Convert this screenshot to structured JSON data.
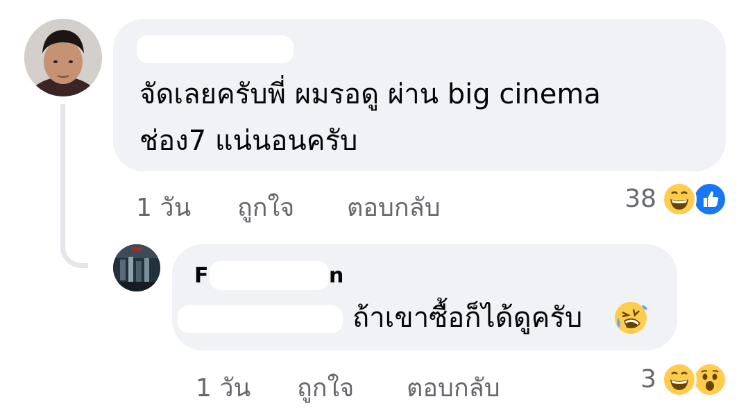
{
  "comments": [
    {
      "author": "",
      "body_lines": [
        "จัดเลยครับพี่ ผมรอดู ผ่าน big cinema",
        "ช่อง7 แน่นอนครับ"
      ],
      "time": "1 วัน",
      "like_label": "ถูกใจ",
      "reply_label": "ตอบกลับ",
      "reaction_count": "38",
      "reactions": [
        "grinning-face",
        "like-thumb"
      ]
    },
    {
      "author_visible": "F",
      "author_visible_end": "n",
      "mention": "",
      "body": "ถ้าเขาซื้อก็ได้ดูครับ",
      "time": "1 วัน",
      "like_label": "ถูกใจ",
      "reply_label": "ตอบกลับ",
      "reaction_count": "3",
      "reactions": [
        "grinning-face",
        "surprised-face"
      ]
    }
  ],
  "colors": {
    "bubble": "#f0f2f5",
    "meta_text": "#65676b",
    "mention": "#216fdb",
    "like_blue": "#1877f2",
    "emoji_yellow": "#ffcc4d"
  }
}
